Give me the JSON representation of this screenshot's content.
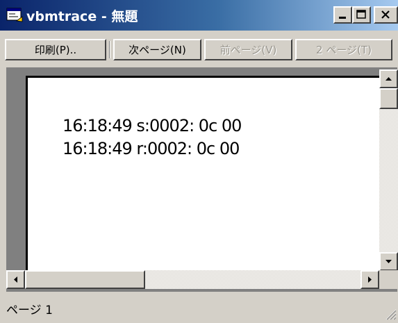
{
  "window": {
    "title": "vbmtrace - 無題"
  },
  "toolbar": {
    "print_label": "印刷(P)..",
    "next_page_label": "次ページ(N)",
    "prev_page_label": "前ページ(V)",
    "two_page_label": "2 ページ(T)"
  },
  "document": {
    "lines": [
      "16:18:49 s:0002: 0c 00",
      "16:18:49 r:0002: 0c 00"
    ]
  },
  "status": {
    "page_label": "ページ 1"
  },
  "colors": {
    "title_gradient_start": "#0a246a",
    "title_gradient_end": "#a6caf0",
    "face": "#d4d0c8",
    "workspace": "#808080"
  },
  "icons": {
    "app": "vb-app-icon",
    "minimize": "minimize-icon",
    "maximize": "maximize-icon",
    "close": "close-icon"
  }
}
